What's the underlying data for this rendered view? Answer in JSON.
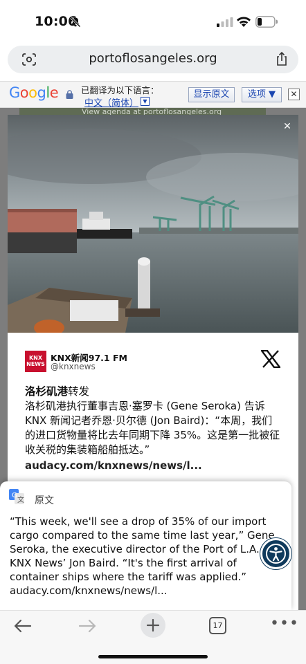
{
  "status_bar": {
    "time": "10:06",
    "icons": [
      "bell-slash-icon",
      "cellular-signal-icon",
      "wifi-icon",
      "battery-icon"
    ]
  },
  "browser": {
    "url": "portoflosangeles.org",
    "icons": [
      "lens-icon",
      "share-icon"
    ]
  },
  "translate_bar": {
    "logo": "Google",
    "label": "已翻译为以下语言：",
    "language": "中文（简体）",
    "show_original_button": "显示原文",
    "options_button": "选项 ▼",
    "close": "✕"
  },
  "page_behind": {
    "partial_text": "View agenda at portoflosangeles.org"
  },
  "post": {
    "account_name": "KNX新闻97.1 FM",
    "account_handle": "@knxnews",
    "logo_text": "KNX NEWS",
    "source_bold": "洛杉矶港",
    "source_suffix": "转发",
    "body": "洛杉矶港执行董事吉恩·塞罗卡 (Gene Seroka) 告诉 KNX 新闻记者乔恩·贝尔德 (Jon Baird)：“本周，我们的进口货物量将比去年同期下降 35%。这是第一批被征收关税的集装箱船舶抵达。”",
    "link": "audacy.com/knxnews/news/l..."
  },
  "original_popup": {
    "label": "原文",
    "text": "“This week, we'll see a drop of 35% of our import cargo compared to the same time last year,” Gene Seroka, the executive director of the Port of L.A., told KNX News’ Jon Baird. “It's the first arrival of container ships where the tariff was applied.”\naudacy.com/knxnews/news/l..."
  },
  "toolbar": {
    "tab_count": "17",
    "menu": "•••"
  },
  "colors": {
    "link_blue": "#1a45b0",
    "knx_red": "#c8102e",
    "a11y_navy": "#0f3a5c"
  }
}
